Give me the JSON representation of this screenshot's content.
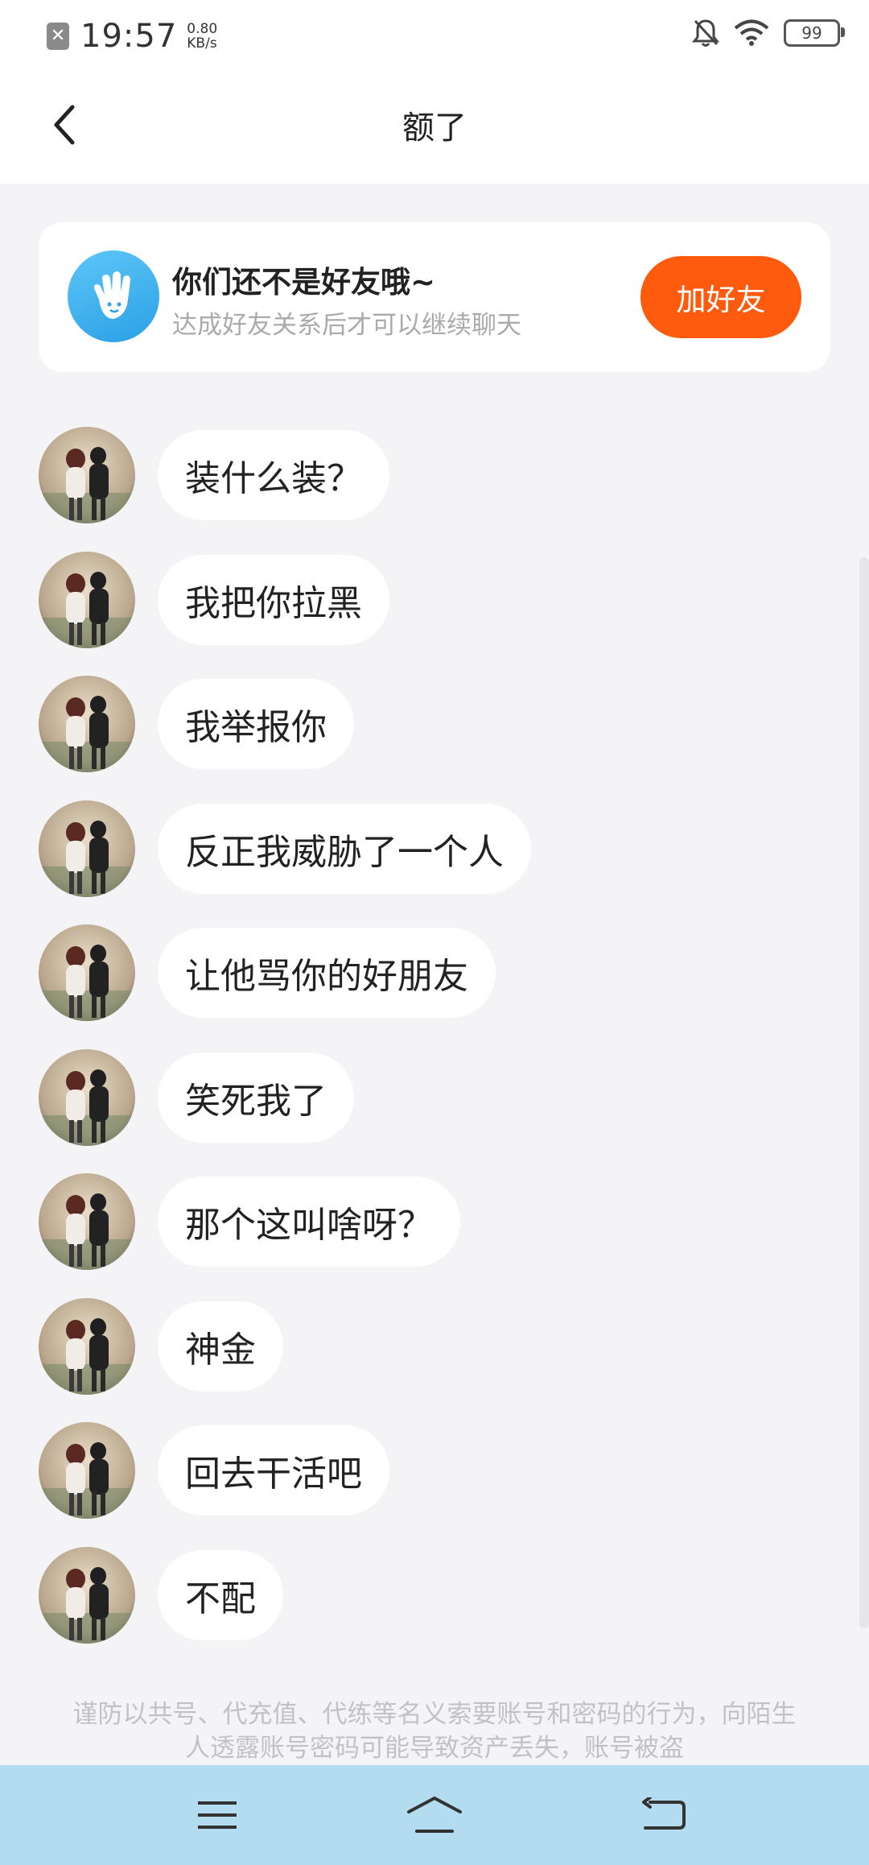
{
  "status_bar": {
    "notification_icon": "x-box-icon",
    "time": "19:57",
    "speed_value": "0.80",
    "speed_unit": "KB/s",
    "battery": "99"
  },
  "header": {
    "title": "额了",
    "back_icon": "chevron-left-icon"
  },
  "friend_card": {
    "title": "你们还不是好友哦~",
    "subtitle": "达成好友关系后才可以继续聊天",
    "button_label": "加好友",
    "button_color": "#ff5b0f"
  },
  "messages": [
    {
      "text": "装什么装？"
    },
    {
      "text": "我把你拉黑"
    },
    {
      "text": "我举报你"
    },
    {
      "text": "反正我威胁了一个人"
    },
    {
      "text": "让他骂你的好朋友"
    },
    {
      "text": "笑死我了"
    },
    {
      "text": "那个这叫啥呀？"
    },
    {
      "text": "神金"
    },
    {
      "text": "回去干活吧"
    },
    {
      "text": "不配"
    }
  ],
  "notice": "谨防以共号、代充值、代练等名义索要账号和密码的行为，向陌生人透露账号密码可能导致资产丢失，账号被盗",
  "nav_bar": {
    "menu_icon": "menu-icon",
    "home_icon": "home-icon",
    "back_icon": "back-icon",
    "color": "#b4dcf0"
  }
}
